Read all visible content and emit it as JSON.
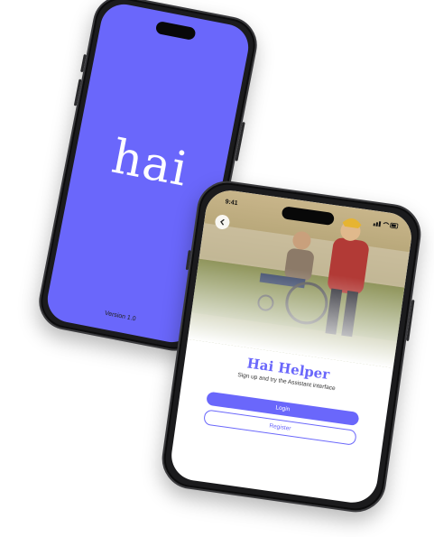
{
  "splash": {
    "logo": "hai",
    "version": "Version 1.0",
    "color": "#6a67fb"
  },
  "welcome": {
    "status_time": "9:41",
    "back_icon": "chevron-left-icon",
    "title": "Hai Helper",
    "subtitle": "Sign up and try the Assistant interface",
    "login_label": "Login",
    "register_label": "Register",
    "accent": "#6a67fb"
  }
}
